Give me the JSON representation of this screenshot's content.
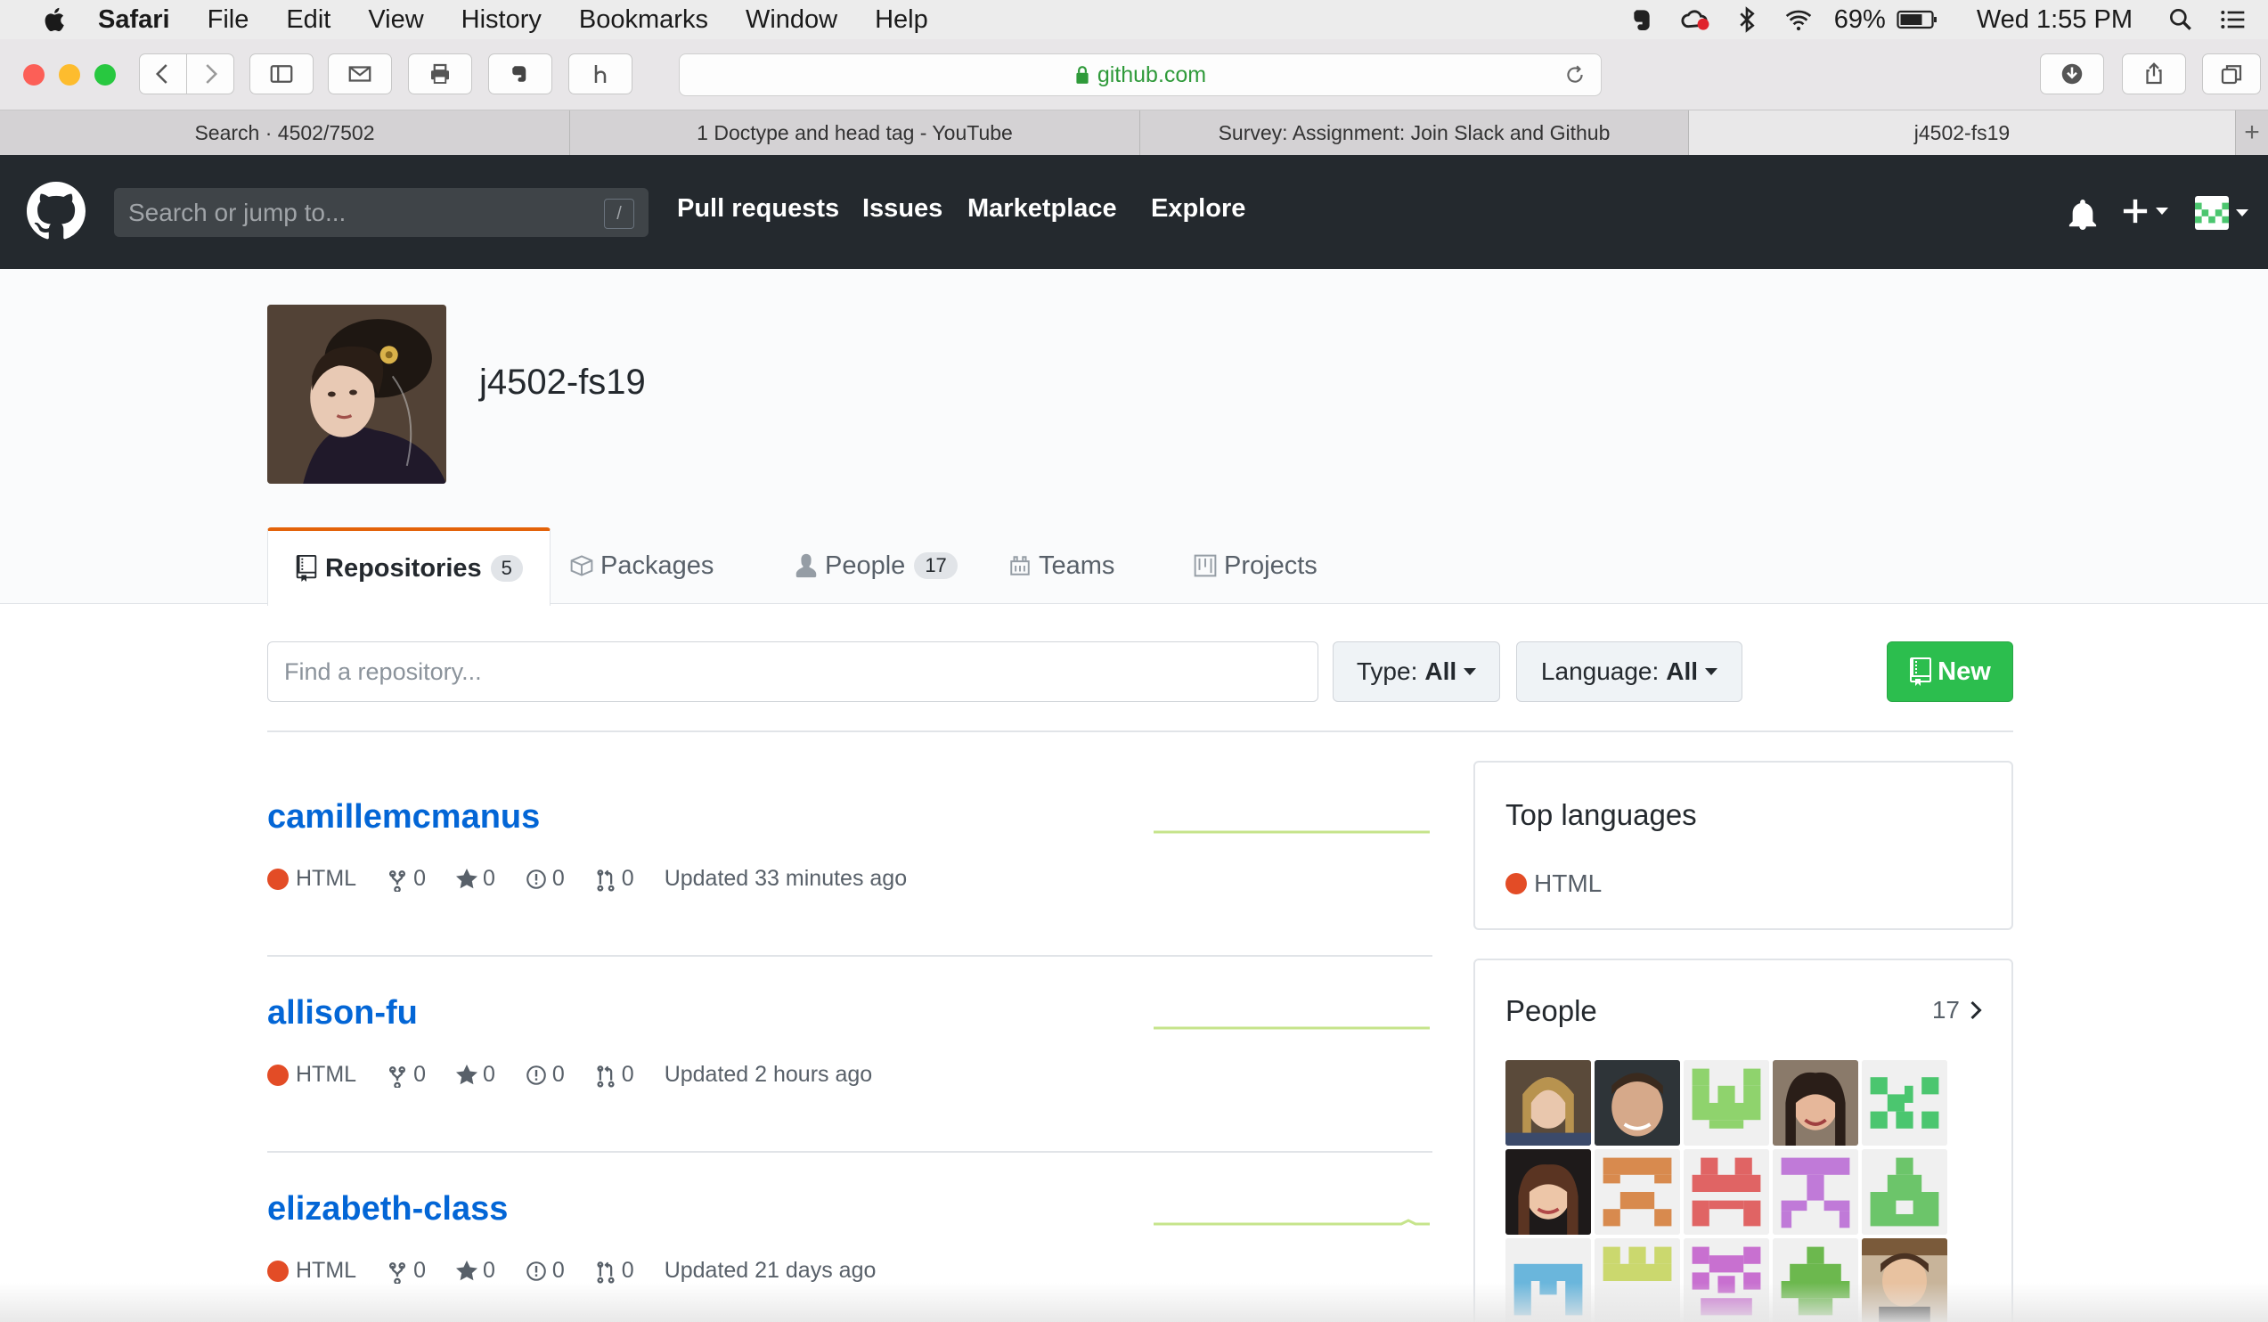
{
  "menubar": {
    "app": "Safari",
    "items": [
      "File",
      "Edit",
      "View",
      "History",
      "Bookmarks",
      "Window",
      "Help"
    ],
    "battery": "69%",
    "clock": "Wed 1:55 PM"
  },
  "browser": {
    "url": "github.com",
    "tabs": [
      {
        "label": "Search · 4502/7502"
      },
      {
        "label": "1 Doctype and head tag - YouTube"
      },
      {
        "label": "Survey: Assignment: Join Slack and Github"
      },
      {
        "label": "j4502-fs19",
        "active": true
      }
    ]
  },
  "github": {
    "search_placeholder": "Search or jump to...",
    "search_hotkey": "/",
    "nav": [
      "Pull requests",
      "Issues",
      "Marketplace",
      "Explore"
    ]
  },
  "org": {
    "name": "j4502-fs19",
    "tabs": [
      {
        "label": "Repositories",
        "count": "5",
        "active": true
      },
      {
        "label": "Packages"
      },
      {
        "label": "People",
        "count": "17"
      },
      {
        "label": "Teams"
      },
      {
        "label": "Projects"
      }
    ]
  },
  "filters": {
    "find_placeholder": "Find a repository...",
    "type_label": "Type:",
    "type_value": "All",
    "language_label": "Language:",
    "language_value": "All",
    "new_label": "New"
  },
  "repos": [
    {
      "name": "camillemcmanus",
      "language": "HTML",
      "forks": "0",
      "stars": "0",
      "issues": "0",
      "prs": "0",
      "updated": "Updated 33 minutes ago"
    },
    {
      "name": "allison-fu",
      "language": "HTML",
      "forks": "0",
      "stars": "0",
      "issues": "0",
      "prs": "0",
      "updated": "Updated 2 hours ago"
    },
    {
      "name": "elizabeth-class",
      "language": "HTML",
      "forks": "0",
      "stars": "0",
      "issues": "0",
      "prs": "0",
      "updated": "Updated 21 days ago"
    }
  ],
  "sidebar": {
    "top_languages_title": "Top languages",
    "top_language": "HTML",
    "people_title": "People",
    "people_count": "17"
  },
  "colors": {
    "html_language": "#e34c26",
    "link": "#0366d6",
    "new_button": "#2cbe4e",
    "header_bg": "#24292e",
    "active_tab_border": "#e36209"
  }
}
